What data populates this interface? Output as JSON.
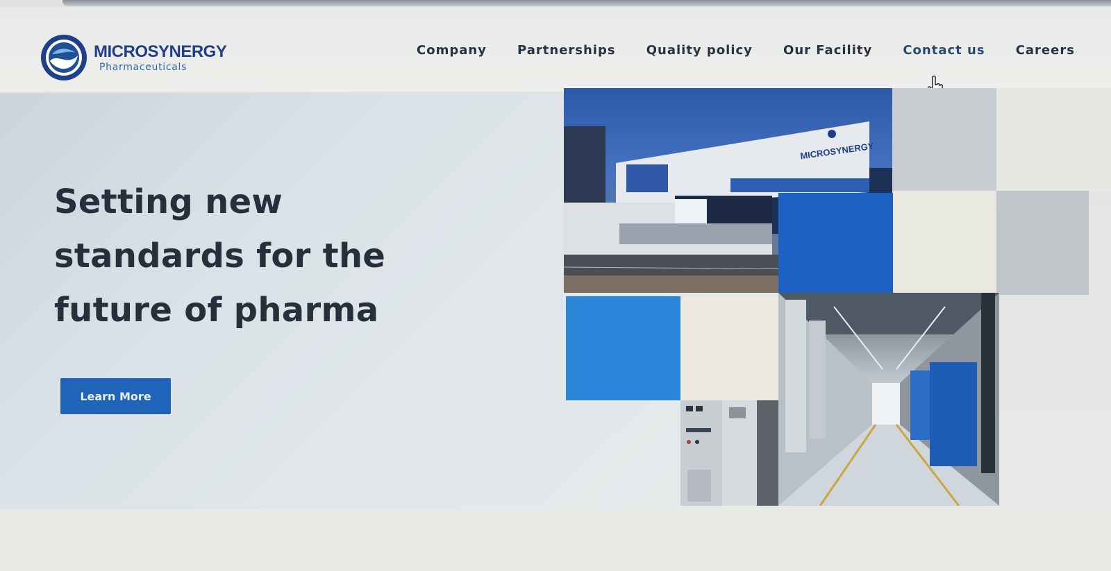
{
  "brand": {
    "name": "MICROSYNERGY",
    "subtitle": "Pharmaceuticals",
    "color": "#1f3f86",
    "accent": "#2b6aa8"
  },
  "nav": {
    "items": [
      {
        "label": "Company"
      },
      {
        "label": "Partnerships"
      },
      {
        "label": "Quality policy"
      },
      {
        "label": "Our Facility"
      },
      {
        "label": "Contact us"
      },
      {
        "label": "Careers"
      }
    ]
  },
  "hero": {
    "headline": "Setting new standards for the future of pharma",
    "cta_label": "Learn More",
    "cta_color": "#1f64b8"
  },
  "photos": {
    "building_sign": "MICROSYNERGY"
  },
  "icons": {
    "cursor": "hand-pointer-icon",
    "logo": "microsynergy-logo-icon"
  }
}
